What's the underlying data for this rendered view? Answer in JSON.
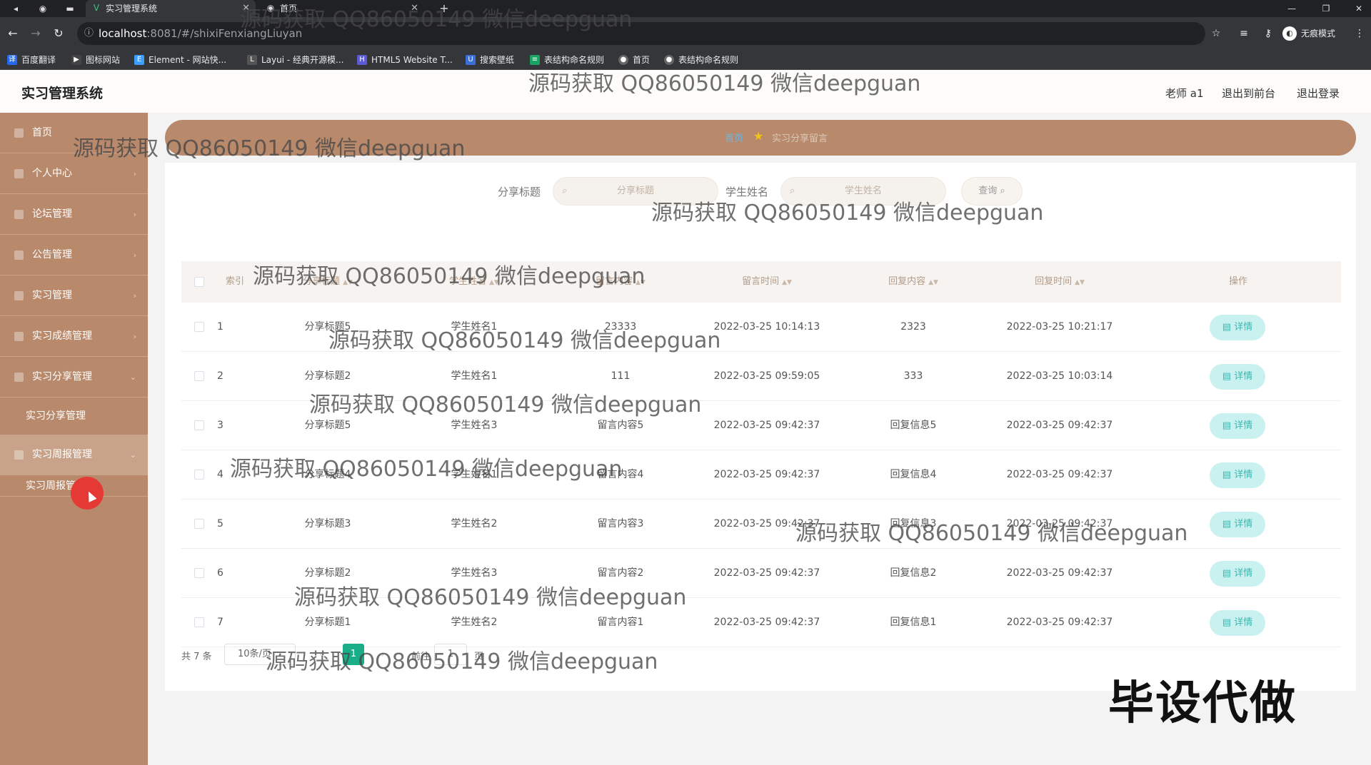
{
  "browser": {
    "tabs": [
      {
        "title": "实习管理系统",
        "active": true
      },
      {
        "title": "首页",
        "active": false
      }
    ],
    "new_tab": "+",
    "url_host": "localhost",
    "url_path": ":8081/#/shixiFenxiangLiuyan",
    "incognito": "无痕模式",
    "bookmarks": [
      {
        "label": "百度翻译",
        "color": "#2468f2",
        "glyph": "译"
      },
      {
        "label": "图标网站",
        "color": "#444444",
        "glyph": "▶"
      },
      {
        "label": "Element - 网站快...",
        "color": "#409eff",
        "glyph": "E"
      },
      {
        "label": "Layui - 经典开源模...",
        "color": "#555555",
        "glyph": "L"
      },
      {
        "label": "HTML5 Website T...",
        "color": "#5b5bd6",
        "glyph": "H"
      },
      {
        "label": "搜索壁纸",
        "color": "#3b6fd8",
        "glyph": "U"
      },
      {
        "label": "表结构命名规则",
        "color": "#1aa260",
        "glyph": "≡"
      },
      {
        "label": "首页",
        "color": "#666666",
        "glyph": "●"
      },
      {
        "label": "表结构命名规则",
        "color": "#666666",
        "glyph": "●"
      }
    ]
  },
  "header": {
    "title": "实习管理系统",
    "user": "老师 a1",
    "back_to_front": "退出到前台",
    "logout": "退出登录"
  },
  "sidebar": {
    "items": [
      {
        "label": "首页"
      },
      {
        "label": "个人中心"
      },
      {
        "label": "论坛管理"
      },
      {
        "label": "公告管理"
      },
      {
        "label": "实习管理"
      },
      {
        "label": "实习成绩管理"
      },
      {
        "label": "实习分享管理"
      },
      {
        "label": "实习分享管理",
        "sub": true
      },
      {
        "label": "实习周报管理"
      },
      {
        "label": "实习周报管理",
        "sub": true
      }
    ]
  },
  "breadcrumb": {
    "home": "首页",
    "current": "实习分享留言"
  },
  "search": {
    "title_label": "分享标题",
    "title_placeholder": "分享标题",
    "student_label": "学生姓名",
    "student_placeholder": "学生姓名",
    "button": "查询"
  },
  "table": {
    "columns": [
      "索引",
      "分享标题",
      "学生姓名",
      "留言内容",
      "留言时间",
      "回复内容",
      "回复时间",
      "操作"
    ],
    "rows": [
      {
        "index": "1",
        "title": "分享标题5",
        "student": "学生姓名1",
        "content": "23333",
        "time": "2022-03-25 10:14:13",
        "reply": "2323",
        "reply_time": "2022-03-25 10:21:17"
      },
      {
        "index": "2",
        "title": "分享标题2",
        "student": "学生姓名1",
        "content": "111",
        "time": "2022-03-25 09:59:05",
        "reply": "333",
        "reply_time": "2022-03-25 10:03:14"
      },
      {
        "index": "3",
        "title": "分享标题5",
        "student": "学生姓名3",
        "content": "留言内容5",
        "time": "2022-03-25 09:42:37",
        "reply": "回复信息5",
        "reply_time": "2022-03-25 09:42:37"
      },
      {
        "index": "4",
        "title": "分享标题4",
        "student": "学生姓名1",
        "content": "留言内容4",
        "time": "2022-03-25 09:42:37",
        "reply": "回复信息4",
        "reply_time": "2022-03-25 09:42:37"
      },
      {
        "index": "5",
        "title": "分享标题3",
        "student": "学生姓名2",
        "content": "留言内容3",
        "time": "2022-03-25 09:42:37",
        "reply": "回复信息3",
        "reply_time": "2022-03-25 09:42:37"
      },
      {
        "index": "6",
        "title": "分享标题2",
        "student": "学生姓名3",
        "content": "留言内容2",
        "time": "2022-03-25 09:42:37",
        "reply": "回复信息2",
        "reply_time": "2022-03-25 09:42:37"
      },
      {
        "index": "7",
        "title": "分享标题1",
        "student": "学生姓名2",
        "content": "留言内容1",
        "time": "2022-03-25 09:42:37",
        "reply": "回复信息1",
        "reply_time": "2022-03-25 09:42:37"
      }
    ],
    "action_label": "详情"
  },
  "pagination": {
    "total": "共 7 条",
    "page_size": "10条/页",
    "current_page": "1",
    "goto_prefix": "前往",
    "goto_value": "1",
    "goto_suffix": "页"
  },
  "watermark": "源码获取 QQ86050149 微信deepguan",
  "stamp": "毕设代做",
  "colors": {
    "sidebar": "#b9896b",
    "accent_green": "#1aae88",
    "detail_button_bg": "#c8f1ef",
    "detail_button_text": "#3bb8b3",
    "breadcrumb_home": "#6ab7e8"
  }
}
